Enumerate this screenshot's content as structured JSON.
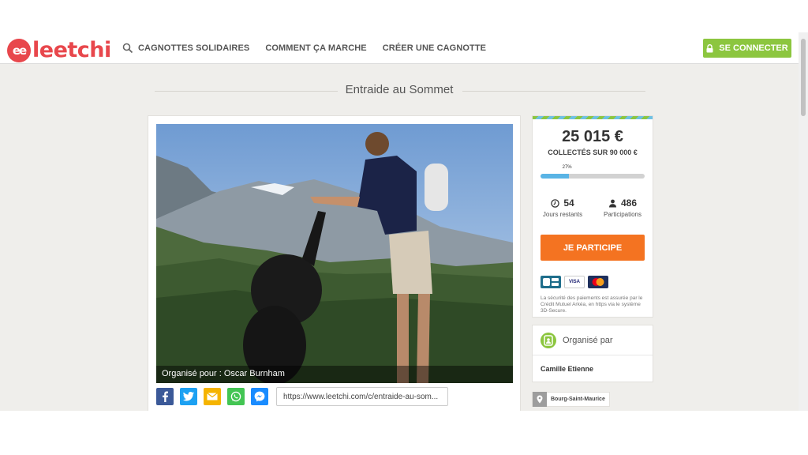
{
  "brand": {
    "logo_badge": "ee",
    "logo_text": "leetchi",
    "accent": "#e8474c"
  },
  "nav": {
    "items": [
      {
        "label": "CAGNOTTES SOLIDAIRES",
        "icon": "search-icon"
      },
      {
        "label": "COMMENT ÇA MARCHE"
      },
      {
        "label": "CRÉER UNE CAGNOTTE"
      }
    ],
    "login_label": "SE CONNECTER",
    "login_color": "#8cc63f"
  },
  "page": {
    "title": "Entraide au Sommet"
  },
  "photo": {
    "caption": "Organisé pour : Oscar Burnham"
  },
  "share": {
    "buttons": [
      "facebook-icon",
      "twitter-icon",
      "email-icon",
      "whatsapp-icon",
      "messenger-icon"
    ],
    "url": "https://www.leetchi.com/c/entraide-au-som..."
  },
  "funding": {
    "amount": "25 015 €",
    "goal_label": "COLLECTÉS SUR 90 000 €",
    "progress_percent": 27,
    "progress_label": "27%",
    "days_left": "54",
    "days_label": "Jours restants",
    "participants": "486",
    "participants_label": "Participations",
    "cta_label": "JE PARTICIPE",
    "cta_color": "#f47321",
    "payment_cards": [
      "CB",
      "VISA",
      "MasterCard"
    ],
    "security_text": "La sécurité des paiements est assurée par le Crédit Mutuel Arkéa, en https via le système 3D-Secure."
  },
  "organizer": {
    "heading": "Organisé par",
    "name": "Camille Etienne"
  },
  "location": {
    "name": "Bourg-Saint-Maurice"
  }
}
